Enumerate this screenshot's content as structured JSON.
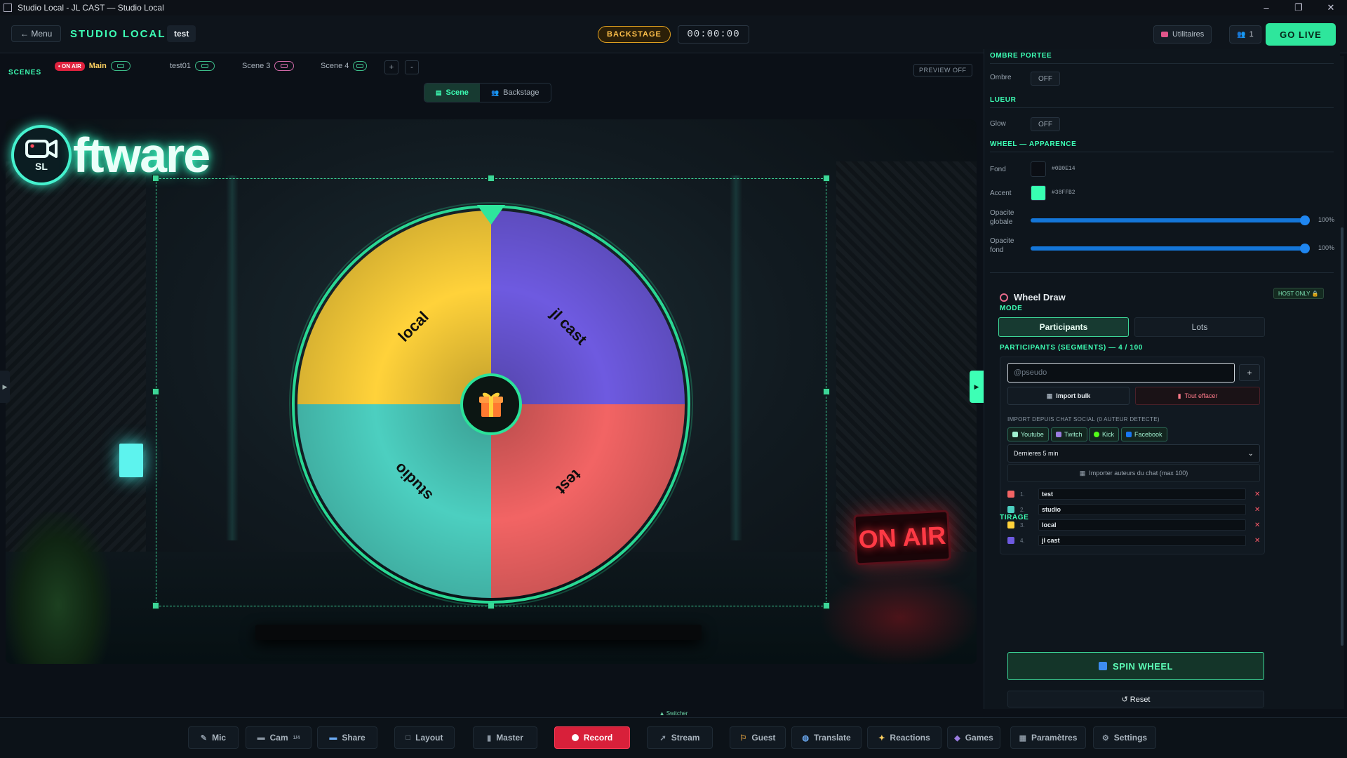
{
  "window": {
    "title": "Studio Local - JL CAST — Studio Local",
    "min": "–",
    "max": "❐",
    "close": "✕"
  },
  "topbar": {
    "menu_label": "← Menu",
    "brand": "STUDIO LOCAL",
    "project": "test",
    "status": "BACKSTAGE",
    "timer": "00:00:00",
    "utilities": "Utilitaires",
    "viewer_count": "1",
    "go_live": "GO LIVE"
  },
  "scenes": {
    "label": "SCENES",
    "on_air": "• ON AIR",
    "tabs": [
      "Main",
      "test01",
      "Scene 3",
      "Scene 4"
    ],
    "add": "+",
    "remove": "-",
    "preview": "PREVIEW OFF"
  },
  "view_switch": {
    "scene": "Scene",
    "backstage": "Backstage"
  },
  "stage": {
    "logo_small": "SL",
    "logo_text": "ftware",
    "sign": "ON AIR"
  },
  "wheel": {
    "segments": [
      {
        "label": "local",
        "color": "#FFD23A"
      },
      {
        "label": "jl cast",
        "color": "#6E5AE0"
      },
      {
        "label": "test",
        "color": "#F26464"
      },
      {
        "label": "studio",
        "color": "#4CCFC0"
      }
    ],
    "accent": "#38FFB2"
  },
  "panel": {
    "shadow_title": "OMBRE PORTEE",
    "shadow_label": "Ombre",
    "shadow_value": "OFF",
    "glow_title": "LUEUR",
    "glow_label": "Glow",
    "glow_value": "OFF",
    "appearance_title": "WHEEL — APPARENCE",
    "bg_label": "Fond",
    "bg_hex": "#0B0E14",
    "accent_label": "Accent",
    "accent_hex": "#38FFB2",
    "opacity_global_label": "Opacite globale",
    "opacity_global": "100%",
    "opacity_bg_label": "Opacite fond",
    "opacity_bg": "100%",
    "wheel_draw_title": "Wheel Draw",
    "host_only": "HOST ONLY 🔒",
    "mode_title": "MODE",
    "mode_participants": "Participants",
    "mode_lots": "Lots",
    "participants_title": "PARTICIPANTS (SEGMENTS) — 4 / 100",
    "pseudo_placeholder": "@pseudo",
    "add_btn": "+",
    "import_bulk": "Import bulk",
    "clear_all": "Tout effacer",
    "import_social_label": "IMPORT DEPUIS CHAT SOCIAL (0 AUTEUR DETECTE)",
    "socials": [
      "Youtube",
      "Twitch",
      "Kick",
      "Facebook"
    ],
    "time_window": "Dernieres 5 min",
    "import_chat": "Importer auteurs du chat (max 100)",
    "participants": [
      {
        "num": "1.",
        "name": "test",
        "color": "#F26464"
      },
      {
        "num": "2.",
        "name": "studio",
        "color": "#4CCFC0"
      },
      {
        "num": "3.",
        "name": "local",
        "color": "#FFD23A"
      },
      {
        "num": "4.",
        "name": "jl cast",
        "color": "#6E5AE0"
      }
    ],
    "draw_title": "TIRAGE",
    "spin": "SPIN WHEEL",
    "reset": "↺ Reset"
  },
  "switcher": "▲ Switcher",
  "bottombar": {
    "mic": "Mic",
    "cam": "Cam",
    "cam_count": "1/4",
    "share": "Share",
    "layout": "Layout",
    "master": "Master",
    "record": "Record",
    "stream": "Stream",
    "guest": "Guest",
    "translate": "Translate",
    "reactions": "Reactions",
    "games": "Games",
    "params": "Paramètres",
    "settings": "Settings"
  }
}
